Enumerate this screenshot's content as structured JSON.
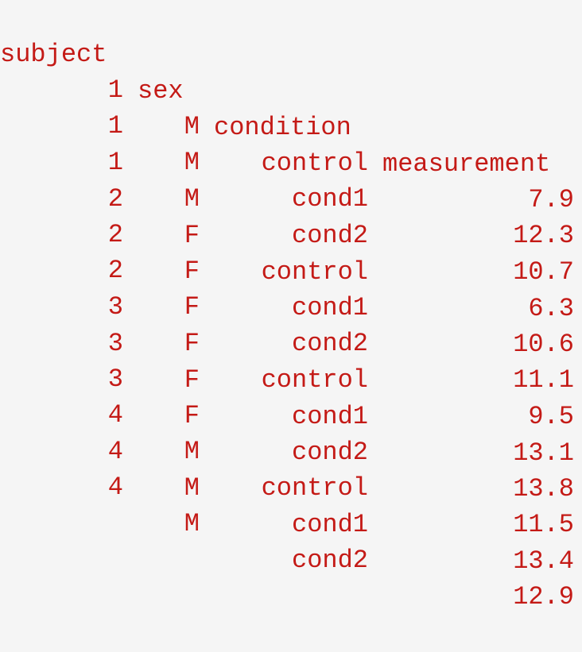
{
  "table": {
    "headers": [
      "subject",
      "sex",
      "condition",
      "measurement"
    ],
    "rows": [
      [
        "1",
        "M",
        "control",
        "7.9"
      ],
      [
        "1",
        "M",
        "cond1",
        "12.3"
      ],
      [
        "1",
        "M",
        "cond2",
        "10.7"
      ],
      [
        "2",
        "F",
        "control",
        "6.3"
      ],
      [
        "2",
        "F",
        "cond1",
        "10.6"
      ],
      [
        "2",
        "F",
        "cond2",
        "11.1"
      ],
      [
        "3",
        "F",
        "control",
        "9.5"
      ],
      [
        "3",
        "F",
        "cond1",
        "13.1"
      ],
      [
        "3",
        "F",
        "cond2",
        "13.8"
      ],
      [
        "4",
        "M",
        "control",
        "11.5"
      ],
      [
        "4",
        "M",
        "cond1",
        "13.4"
      ],
      [
        "4",
        "M",
        "cond2",
        "12.9"
      ]
    ]
  }
}
